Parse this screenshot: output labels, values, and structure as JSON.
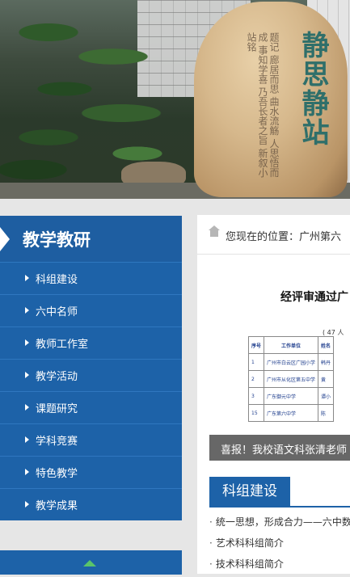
{
  "banner": {
    "rock_title": "静思静站",
    "rock_inscription": "题记 廊居而思 曲水流觞 人思悟而成 事知学喜 乃吾长者之旨 新叙小站铭"
  },
  "sidebar": {
    "title": "教学教研",
    "items": [
      {
        "label": "科组建设"
      },
      {
        "label": "六中名师"
      },
      {
        "label": "教师工作室"
      },
      {
        "label": "教学活动"
      },
      {
        "label": "课题研究"
      },
      {
        "label": "学科竞赛"
      },
      {
        "label": "特色教学"
      },
      {
        "label": "教学成果"
      }
    ]
  },
  "breadcrumb": {
    "prefix": "您现在的位置：广州第六"
  },
  "slide": {
    "doc_title": "经评审通过广",
    "doc_sub": "( 47 人",
    "table_headers": [
      "序号",
      "工作单位",
      "姓名"
    ],
    "table_rows": [
      [
        "1",
        "广州市白云区广园小学",
        "韩丹"
      ],
      [
        "2",
        "广州市从化区第五中学",
        "黄"
      ],
      [
        "3",
        "广东御元中学",
        "谭小"
      ],
      [
        "15",
        "广东第六中学",
        "陈"
      ]
    ],
    "caption": "喜报！我校语文科张清老师"
  },
  "section": {
    "title": "科组建设"
  },
  "news": [
    {
      "text": "统一思想，形成合力——六中数"
    },
    {
      "text": "艺术科科组简介"
    },
    {
      "text": "技术科科组简介"
    }
  ]
}
